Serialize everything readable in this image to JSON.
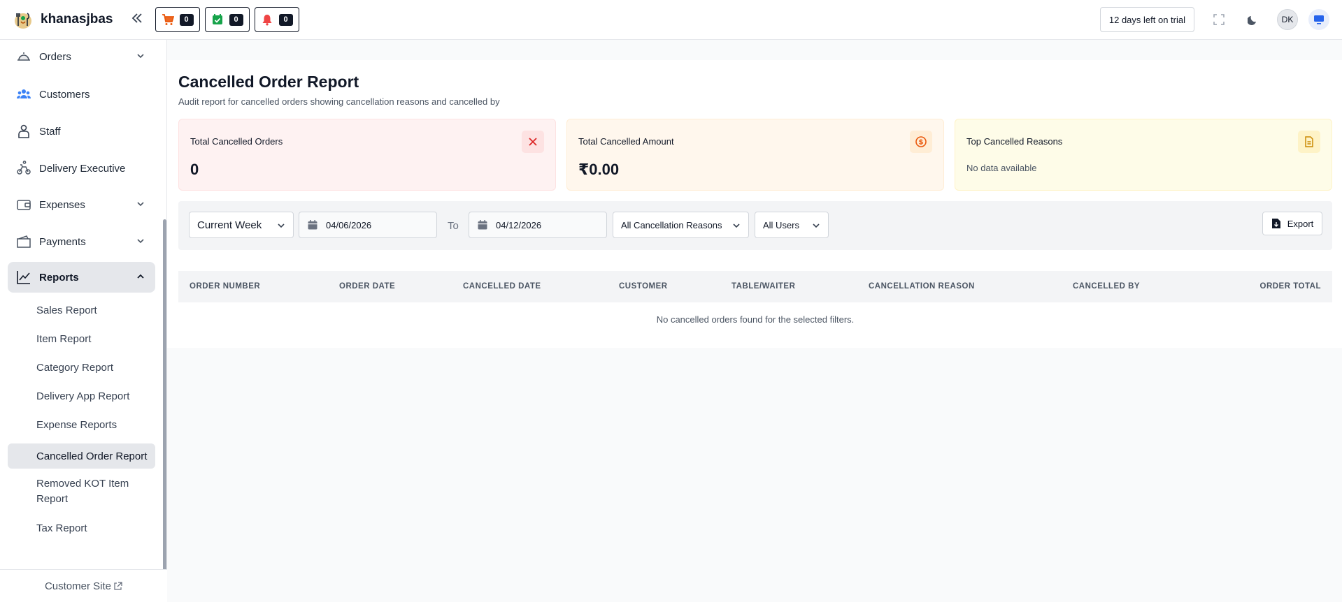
{
  "header": {
    "brand": "khanasjbas",
    "counters": {
      "cart": "0",
      "orders": "0",
      "notifications": "0"
    },
    "trial": "12 days left on trial",
    "avatar": "DK"
  },
  "sidebar": {
    "items": [
      {
        "label": "Orders",
        "icon": "dish-icon"
      },
      {
        "label": "Customers",
        "icon": "users-icon"
      },
      {
        "label": "Staff",
        "icon": "staff-icon"
      },
      {
        "label": "Delivery Executive",
        "icon": "bike-icon"
      },
      {
        "label": "Expenses",
        "icon": "wallet-icon"
      },
      {
        "label": "Payments",
        "icon": "payments-icon"
      },
      {
        "label": "Reports",
        "icon": "chart-icon"
      }
    ],
    "sub_items": [
      "Sales Report",
      "Item Report",
      "Category Report",
      "Delivery App Report",
      "Expense Reports",
      "Cancelled Order Report",
      "Removed KOT Item Report",
      "Tax Report"
    ],
    "customer_site": "Customer Site"
  },
  "page": {
    "title": "Cancelled Order Report",
    "subtitle": "Audit report for cancelled orders showing cancellation reasons and cancelled by"
  },
  "cards": {
    "total_orders": {
      "label": "Total Cancelled Orders",
      "value": "0"
    },
    "total_amount": {
      "label": "Total Cancelled Amount",
      "value": "₹0.00"
    },
    "top_reasons": {
      "label": "Top Cancelled Reasons",
      "value": "No data available"
    }
  },
  "filters": {
    "period": "Current Week",
    "from_date": "04/06/2026",
    "to_label": "To",
    "to_date": "04/12/2026",
    "reason": "All Cancellation Reasons",
    "user": "All Users",
    "export": "Export"
  },
  "table": {
    "headers": [
      "Order Number",
      "Order Date",
      "Cancelled Date",
      "Customer",
      "Table/Waiter",
      "Cancellation Reason",
      "Cancelled By",
      "Order Total"
    ],
    "empty": "No cancelled orders found for the selected filters."
  },
  "colors": {
    "red": "#dc2626",
    "orange": "#ea580c",
    "yellow": "#ca8a04",
    "blue_accent": "#2563eb",
    "green": "#16a34a"
  }
}
